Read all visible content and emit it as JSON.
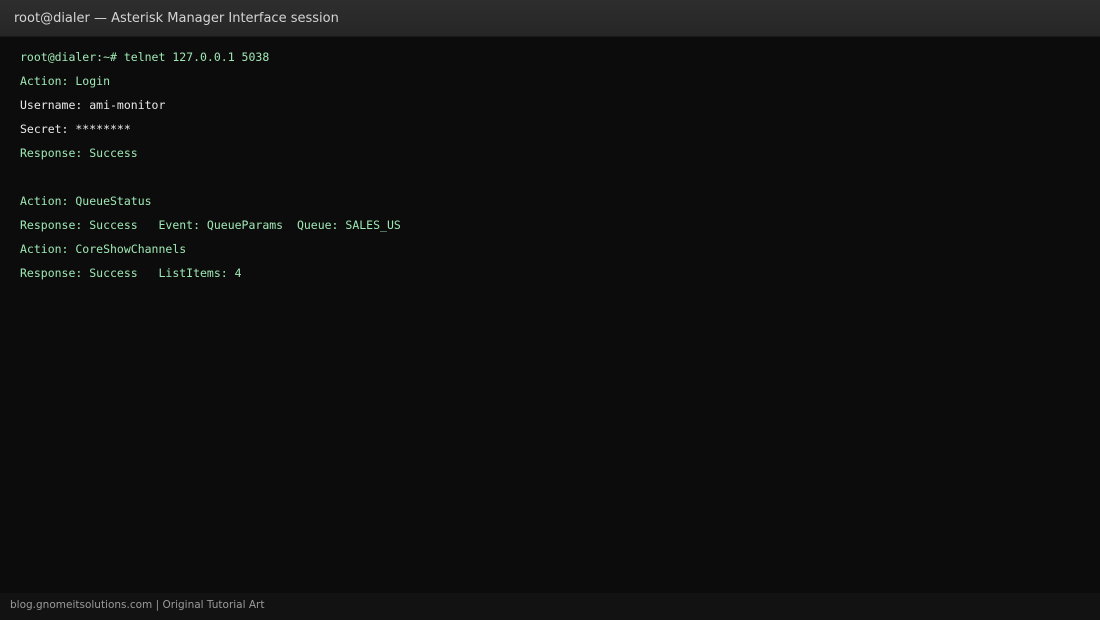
{
  "window": {
    "title": "root@dialer — Asterisk Manager Interface session"
  },
  "terminal": {
    "lines": [
      {
        "text": "root@dialer:~# telnet 127.0.0.1 5038",
        "color": "#9fe7b4"
      },
      {
        "text": "Action: Login",
        "color": "#9fe7b4"
      },
      {
        "text": "Username: ami-monitor",
        "color": "#e8e8e8"
      },
      {
        "text": "Secret: ********",
        "color": "#e8e8e8"
      },
      {
        "text": "Response: Success",
        "color": "#9fe7b4"
      },
      {
        "text": "",
        "color": "#e8e8e8"
      },
      {
        "text": "Action: QueueStatus",
        "color": "#9fe7b4"
      },
      {
        "text": "Response: Success   Event: QueueParams  Queue: SALES_US",
        "color": "#9fe7b4"
      },
      {
        "text": "Action: CoreShowChannels",
        "color": "#9fe7b4"
      },
      {
        "text": "Response: Success   ListItems: 4",
        "color": "#9fe7b4"
      }
    ]
  },
  "footer": {
    "credit": "blog.gnomeitsolutions.com | Original Tutorial Art"
  }
}
